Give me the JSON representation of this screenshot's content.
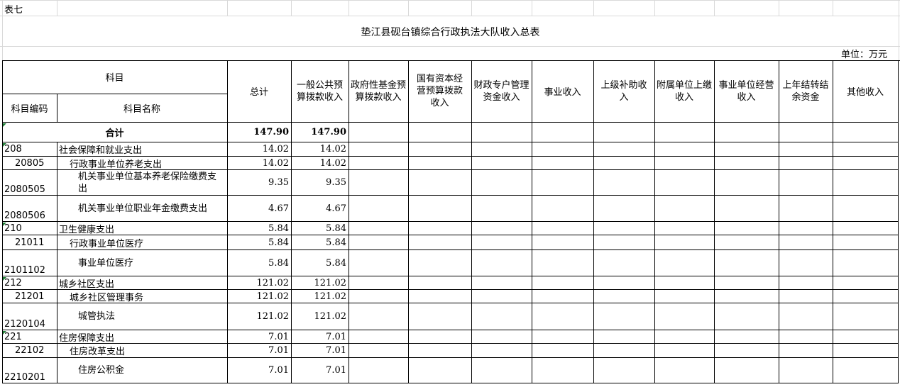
{
  "sheet_label": "表七",
  "title": "垫江县砚台镇综合行政执法大队收入总表",
  "unit": "单位：万元",
  "headers": {
    "subject_group": "科目",
    "code": "科目编码",
    "name": "科目名称",
    "total": "总计",
    "general_budget": "一般公共预算拨款收入",
    "gov_fund": "政府性基金预算拨款收入",
    "state_capital": "国有资本经营预算拨款收入",
    "fiscal_special": "财政专户管理资金收入",
    "business": "事业收入",
    "upper_subsidy": "上级补助收入",
    "affiliate": "附属单位上缴收入",
    "business_operation": "事业单位经营收入",
    "carryover": "上年结转结余资金",
    "other": "其他收入"
  },
  "summary": {
    "label": "合计",
    "total": "147.90",
    "general": "147.90"
  },
  "rows": [
    {
      "code": "208",
      "name": "社会保障和就业支出",
      "total": "14.02",
      "general": "14.02"
    },
    {
      "code": "20805",
      "name": "行政事业单位养老支出",
      "total": "14.02",
      "general": "14.02"
    },
    {
      "code": "2080505",
      "name": "机关事业单位基本养老保险缴费支出",
      "total": "9.35",
      "general": "9.35"
    },
    {
      "code": "2080506",
      "name": "机关事业单位职业年金缴费支出",
      "total": "4.67",
      "general": "4.67"
    },
    {
      "code": "210",
      "name": "卫生健康支出",
      "total": "5.84",
      "general": "5.84"
    },
    {
      "code": "21011",
      "name": "行政事业单位医疗",
      "total": "5.84",
      "general": "5.84"
    },
    {
      "code": "2101102",
      "name": "事业单位医疗",
      "total": "5.84",
      "general": "5.84"
    },
    {
      "code": "212",
      "name": "城乡社区支出",
      "total": "121.02",
      "general": "121.02"
    },
    {
      "code": "21201",
      "name": "城乡社区管理事务",
      "total": "121.02",
      "general": "121.02"
    },
    {
      "code": "2120104",
      "name": "城管执法",
      "total": "121.02",
      "general": "121.02"
    },
    {
      "code": "221",
      "name": "住房保障支出",
      "total": "7.01",
      "general": "7.01"
    },
    {
      "code": "22102",
      "name": "住房改革支出",
      "total": "7.01",
      "general": "7.01"
    },
    {
      "code": "2210201",
      "name": "住房公积金",
      "total": "7.01",
      "general": "7.01"
    }
  ]
}
